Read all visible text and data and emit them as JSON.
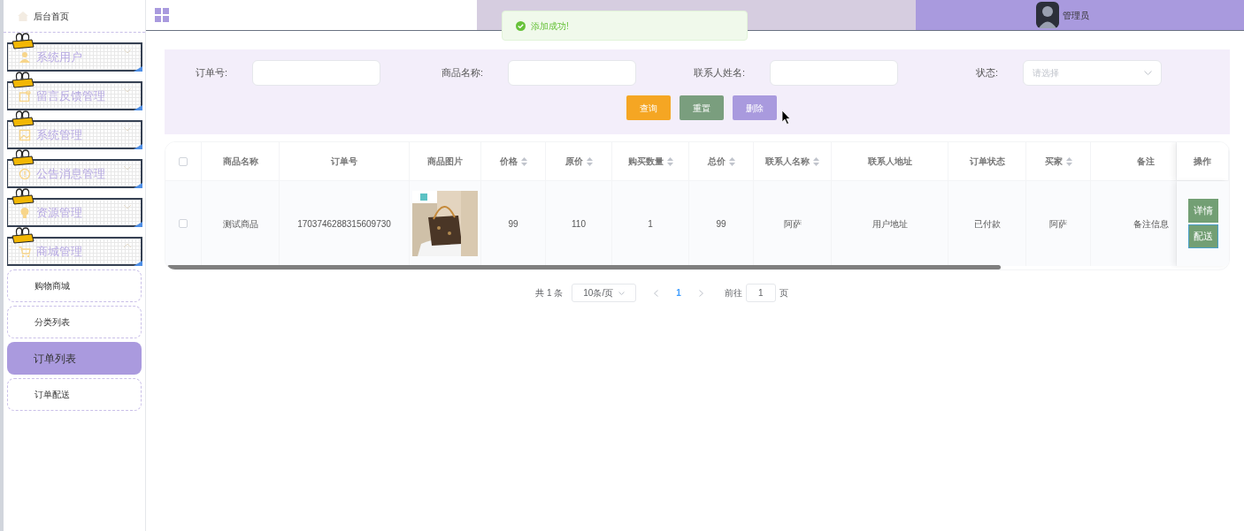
{
  "sidebar": {
    "home": {
      "label": "后台首页"
    },
    "menus": [
      {
        "label": "系统用户",
        "expanded": false
      },
      {
        "label": "留言反馈管理",
        "expanded": false
      },
      {
        "label": "系统管理",
        "expanded": false
      },
      {
        "label": "公告消息管理",
        "expanded": false
      },
      {
        "label": "资源管理",
        "expanded": false
      },
      {
        "label": "商城管理",
        "expanded": true,
        "children": [
          {
            "label": "购物商城",
            "selected": false
          },
          {
            "label": "分类列表",
            "selected": false
          },
          {
            "label": "订单列表",
            "selected": true
          },
          {
            "label": "订单配送",
            "selected": false
          }
        ]
      }
    ]
  },
  "header": {
    "user": "管理员"
  },
  "toast": {
    "message": "添加成功!"
  },
  "search": {
    "fields": [
      {
        "label": "订单号:",
        "kind": "input"
      },
      {
        "label": "商品名称:",
        "kind": "input"
      },
      {
        "label": "联系人姓名:",
        "kind": "input"
      },
      {
        "label": "状态:",
        "kind": "select",
        "placeholder": "请选择"
      }
    ],
    "buttons": [
      {
        "label": "查询",
        "color": "#f5a623"
      },
      {
        "label": "重置",
        "color": "#7a9e7e"
      },
      {
        "label": "删除",
        "color": "#a99ade"
      }
    ]
  },
  "table": {
    "select_all": {
      "checked": false
    },
    "columns": [
      {
        "label": "商品名称",
        "sortable": false
      },
      {
        "label": "订单号",
        "sortable": false
      },
      {
        "label": "商品图片",
        "sortable": false
      },
      {
        "label": "价格",
        "sortable": true
      },
      {
        "label": "原价",
        "sortable": true
      },
      {
        "label": "购买数量",
        "sortable": true
      },
      {
        "label": "总价",
        "sortable": true
      },
      {
        "label": "联系人名称",
        "sortable": true
      },
      {
        "label": "联系人地址",
        "sortable": false
      },
      {
        "label": "订单状态",
        "sortable": false
      },
      {
        "label": "买家",
        "sortable": true
      },
      {
        "label": "备注",
        "sortable": false
      },
      {
        "label": "操作",
        "sortable": false
      }
    ],
    "rows": [
      {
        "checked": false,
        "cells": [
          {
            "kind": "text",
            "text": "测试商品"
          },
          {
            "kind": "text",
            "text": "1703746288315609730"
          },
          {
            "kind": "picture"
          },
          {
            "kind": "text",
            "text": "99"
          },
          {
            "kind": "text",
            "text": "110"
          },
          {
            "kind": "text",
            "text": "1"
          },
          {
            "kind": "text",
            "text": "99"
          },
          {
            "kind": "text",
            "text": "阿萨"
          },
          {
            "kind": "text",
            "text": "用户地址"
          },
          {
            "kind": "text",
            "text": "已付款"
          },
          {
            "kind": "text",
            "text": "阿萨"
          },
          {
            "kind": "note",
            "text": "备注信息"
          }
        ],
        "actions": [
          "详情",
          "配送"
        ]
      }
    ]
  },
  "pagination": {
    "total": "共 1 条",
    "page_size": "10条/页",
    "pages": [
      {
        "label": "1",
        "selected": true
      }
    ],
    "goto_label": "前往",
    "goto_value": "1",
    "goto_suffix": "页"
  }
}
